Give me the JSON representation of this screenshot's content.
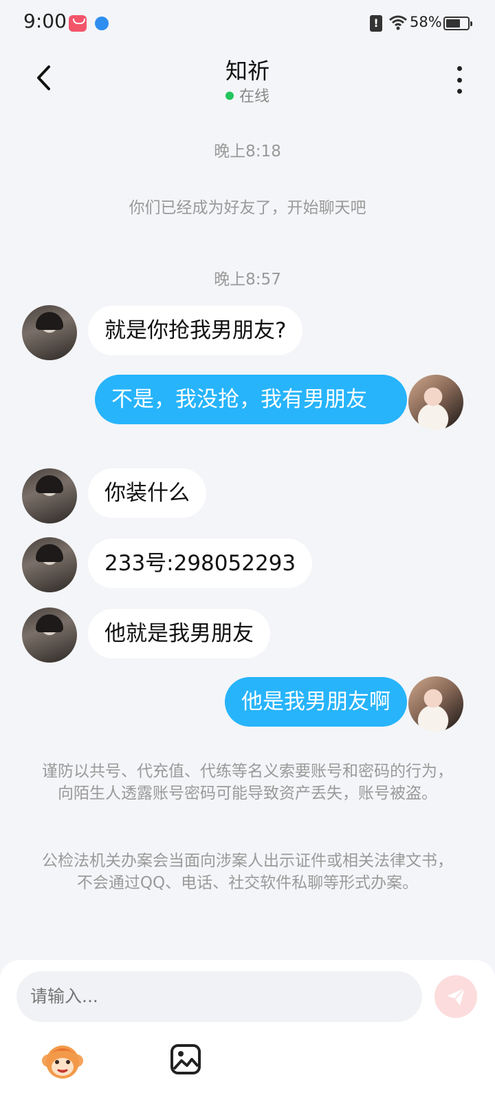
{
  "status_bar": {
    "time": "9:00",
    "battery_percent": "58%",
    "alert_glyph": "!"
  },
  "header": {
    "title": "知祈",
    "status": "在线"
  },
  "chat": {
    "time_separators": [
      "晚上8:18",
      "晚上8:57"
    ],
    "system_message": "你们已经成为好友了，开始聊天吧",
    "messages": [
      {
        "side": "left",
        "text": "就是你抢我男朋友?"
      },
      {
        "side": "right",
        "text": "不是，我没抢，我有男朋友"
      },
      {
        "side": "left",
        "text": "你装什么"
      },
      {
        "side": "left",
        "text": "233号:298052293"
      },
      {
        "side": "left",
        "text": "他就是我男朋友"
      },
      {
        "side": "right",
        "text": "他是我男朋友啊"
      }
    ],
    "notices": [
      "谨防以共号、代充值、代练等名义索要账号和密码的行为，向陌生人透露账号密码可能导致资产丢失，账号被盗。",
      "公检法机关办案会当面向涉案人出示证件或相关法律文书，不会通过QQ、电话、社交软件私聊等形式办案。"
    ]
  },
  "input": {
    "placeholder": "请输入..."
  },
  "colors": {
    "background": "#f4f5f8",
    "bubble_self": "#27b4fb",
    "bubble_other": "#ffffff",
    "online": "#22c55e",
    "send_button": "#fcdcdc"
  },
  "icons": {
    "back": "chevron-left-icon",
    "more": "more-vertical-icon",
    "send": "send-icon",
    "emoji": "monkey-emoji-icon",
    "image": "image-icon"
  }
}
